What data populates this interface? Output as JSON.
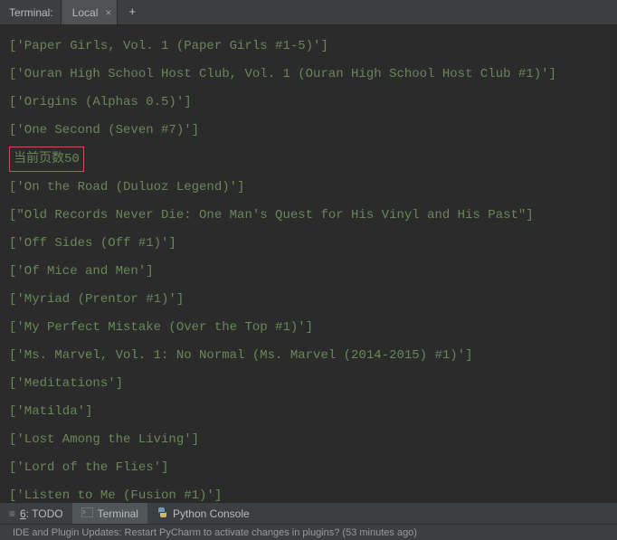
{
  "top": {
    "label": "Terminal:",
    "tab": "Local",
    "plus": "+"
  },
  "output": {
    "lines_before": [
      "['Paper Girls, Vol. 1 (Paper Girls #1-5)']",
      "['Ouran High School Host Club, Vol. 1 (Ouran High School Host Club #1)']",
      "['Origins (Alphas 0.5)']",
      "['One Second (Seven #7)']"
    ],
    "highlight": "当前页数50",
    "lines_after": [
      "['On the Road (Duluoz Legend)']",
      "[\"Old Records Never Die: One Man's Quest for His Vinyl and His Past\"]",
      "['Off Sides (Off #1)']",
      "['Of Mice and Men']",
      "['Myriad (Prentor #1)']",
      "['My Perfect Mistake (Over the Top #1)']",
      "['Ms. Marvel, Vol. 1: No Normal (Ms. Marvel (2014-2015) #1)']",
      "['Meditations']",
      "['Matilda']",
      "['Lost Among the Living']",
      "['Lord of the Flies']",
      "['Listen to Me (Fusion #1)']"
    ]
  },
  "bottom": {
    "todo_key": "6",
    "todo": ": TODO",
    "terminal": "Terminal",
    "python": "Python Console"
  },
  "status": "IDE and Plugin Updates: Restart PyCharm to activate changes in plugins? (53 minutes ago)"
}
